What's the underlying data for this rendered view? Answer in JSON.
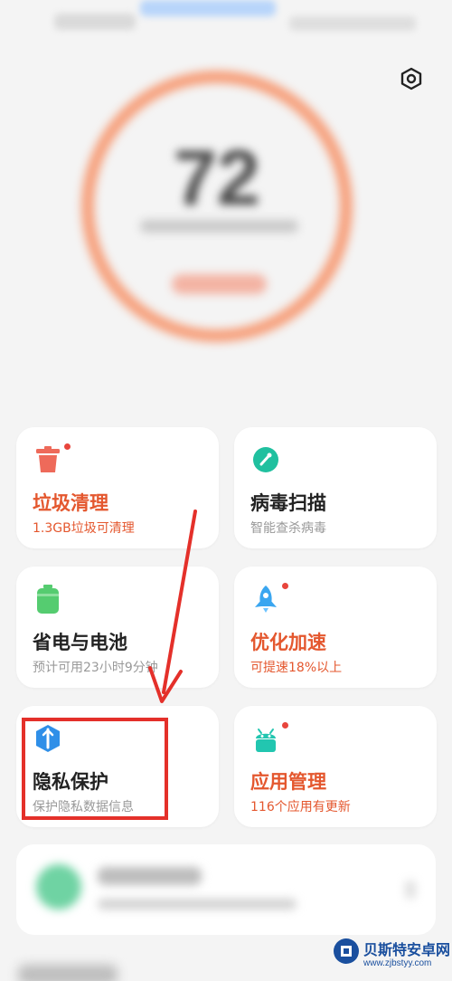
{
  "score": {
    "value": "72"
  },
  "cards": [
    {
      "title": "垃圾清理",
      "subtitle": "1.3GB垃圾可清理",
      "icon": "trash-icon",
      "has_dot": true,
      "accent": "#e4572e"
    },
    {
      "title": "病毒扫描",
      "subtitle": "智能查杀病毒",
      "icon": "virus-scan-icon",
      "has_dot": false,
      "accent": "#1fc0a0"
    },
    {
      "title": "省电与电池",
      "subtitle": "预计可用23小时9分钟",
      "icon": "battery-icon",
      "has_dot": false,
      "accent": "#4cc96b"
    },
    {
      "title": "优化加速",
      "subtitle": "可提速18%以上",
      "icon": "rocket-icon",
      "has_dot": true,
      "accent": "#e4572e"
    },
    {
      "title": "隐私保护",
      "subtitle": "保护隐私数据信息",
      "icon": "privacy-shield-icon",
      "has_dot": false,
      "accent": "#2f8fe8"
    },
    {
      "title": "应用管理",
      "subtitle": "116个应用有更新",
      "icon": "android-app-icon",
      "has_dot": true,
      "accent": "#e4572e"
    }
  ],
  "watermark": {
    "name": "贝斯特安卓网",
    "url": "www.zjbstyy.com"
  },
  "colors": {
    "orange_accent": "#e4572e",
    "annotation_red": "#e4302a",
    "background": "#f4f4f4"
  }
}
